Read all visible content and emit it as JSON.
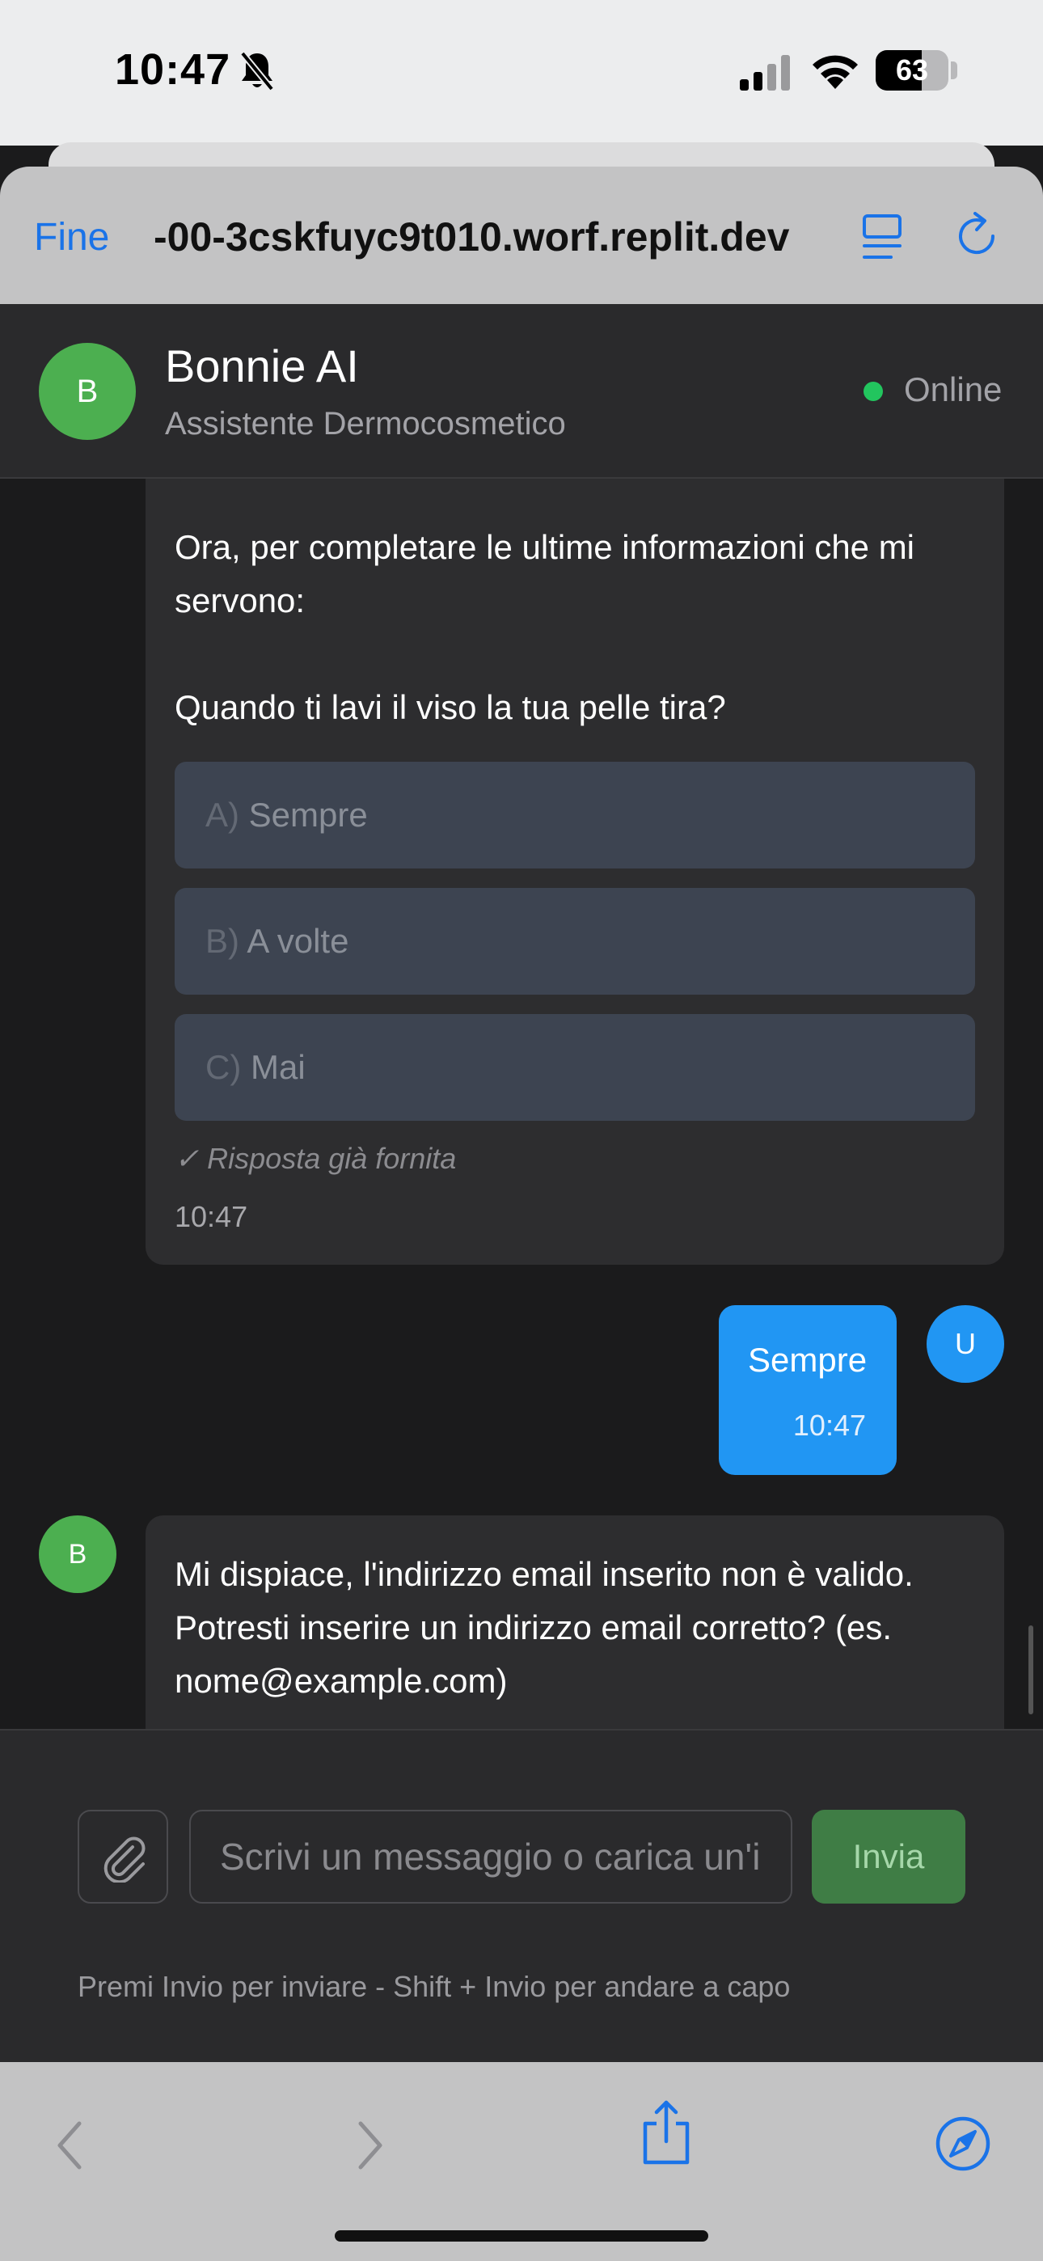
{
  "status_bar": {
    "time": "10:47",
    "battery_percent": "63",
    "battery_level": 0.63
  },
  "browser": {
    "done_label": "Fine",
    "url": "-00-3cskfuyc9t010.worf.replit.dev"
  },
  "chat_header": {
    "avatar_initial": "B",
    "name": "Bonnie AI",
    "subtitle": "Assistente Dermocosmetico",
    "status": "Online",
    "status_color": "#22c55e"
  },
  "messages": {
    "bot_question": {
      "intro": "Ora, per completare le ultime informazioni che mi servono:",
      "question": "Quando ti lavi il viso la tua pelle tira?",
      "options": [
        {
          "prefix": "A)",
          "label": "Sempre"
        },
        {
          "prefix": "B)",
          "label": "A volte"
        },
        {
          "prefix": "C)",
          "label": "Mai"
        }
      ],
      "answered_note": "✓ Risposta già fornita",
      "time": "10:47"
    },
    "user_reply": {
      "avatar_initial": "U",
      "text": "Sempre",
      "time": "10:47"
    },
    "bot_reply": {
      "avatar_initial": "B",
      "text": "Mi dispiace, l'indirizzo email inserito non è valido. Potresti inserire un indirizzo email corretto? (es. nome@example.com)"
    }
  },
  "composer": {
    "placeholder": "Scrivi un messaggio o carica un'immagine...",
    "send_label": "Invia",
    "hint": "Premi Invio per inviare - Shift + Invio per andare a capo"
  },
  "colors": {
    "bot_avatar": "#4caf50",
    "user_bubble": "#2196f3",
    "browser_accent": "#1a73e8",
    "send_button": "#3f7d45"
  },
  "icons": {
    "status_bar": [
      "bell-slash-icon",
      "cellular-signal-icon",
      "wifi-icon",
      "battery-icon"
    ],
    "browser_bar": [
      "reader-mode-icon",
      "reload-icon"
    ],
    "composer": [
      "paperclip-icon"
    ],
    "safari_toolbar": [
      "back-arrow-icon",
      "forward-arrow-icon",
      "share-icon",
      "compass-icon"
    ]
  }
}
